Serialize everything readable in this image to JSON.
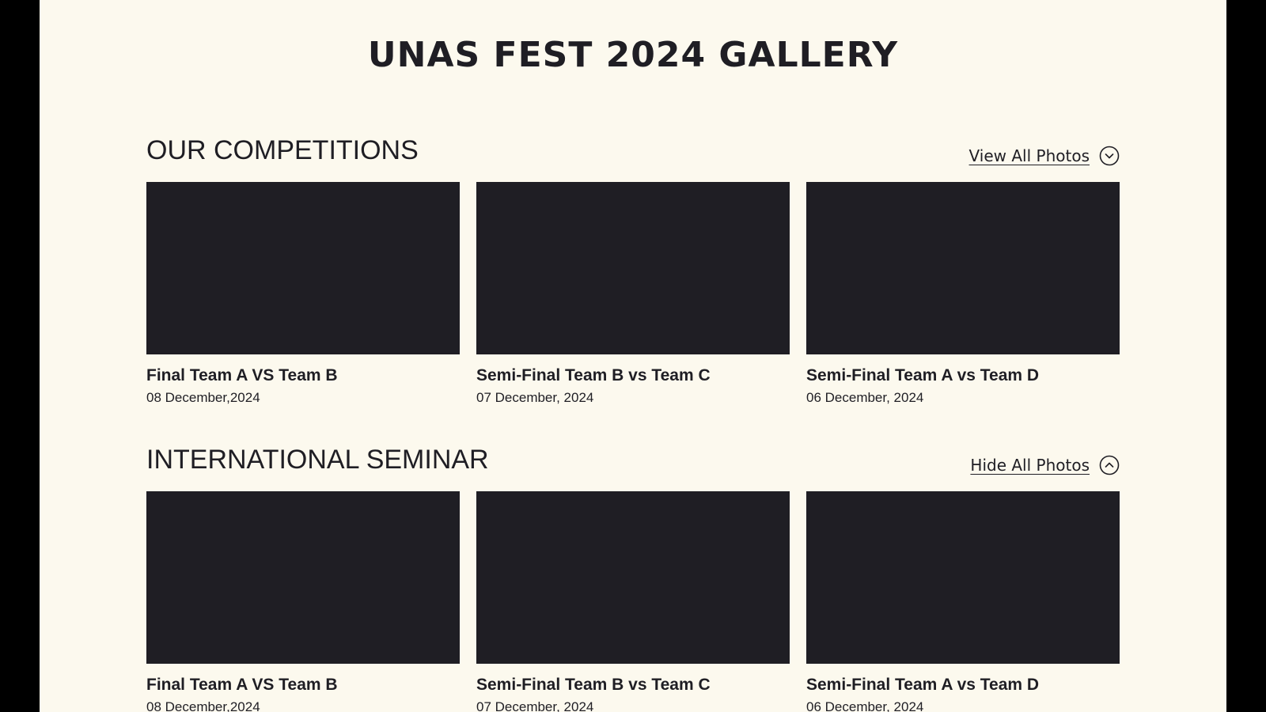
{
  "page": {
    "title": "UNAS FEST 2024 GALLERY",
    "colors": {
      "background": "#fcf9ee",
      "frame": "#000000",
      "text": "#1f1e24",
      "thumbnail": "#1f1e24"
    }
  },
  "sections": [
    {
      "title": "OUR COMPETITIONS",
      "toggle_label": "View All Photos",
      "toggle_icon": "chevron-down-circle-icon",
      "cards": [
        {
          "title": "Final Team A VS Team B",
          "date": "08 December,2024"
        },
        {
          "title": "Semi-Final Team B vs Team C",
          "date": "07 December, 2024"
        },
        {
          "title": "Semi-Final Team A vs Team D",
          "date": "06 December, 2024"
        }
      ]
    },
    {
      "title": "INTERNATIONAL SEMINAR",
      "toggle_label": "Hide All Photos",
      "toggle_icon": "chevron-up-circle-icon",
      "cards": [
        {
          "title": "Final Team A VS Team B",
          "date": "08 December,2024"
        },
        {
          "title": "Semi-Final Team B vs Team C",
          "date": "07 December, 2024"
        },
        {
          "title": "Semi-Final Team A vs Team D",
          "date": "06 December, 2024"
        }
      ]
    }
  ]
}
